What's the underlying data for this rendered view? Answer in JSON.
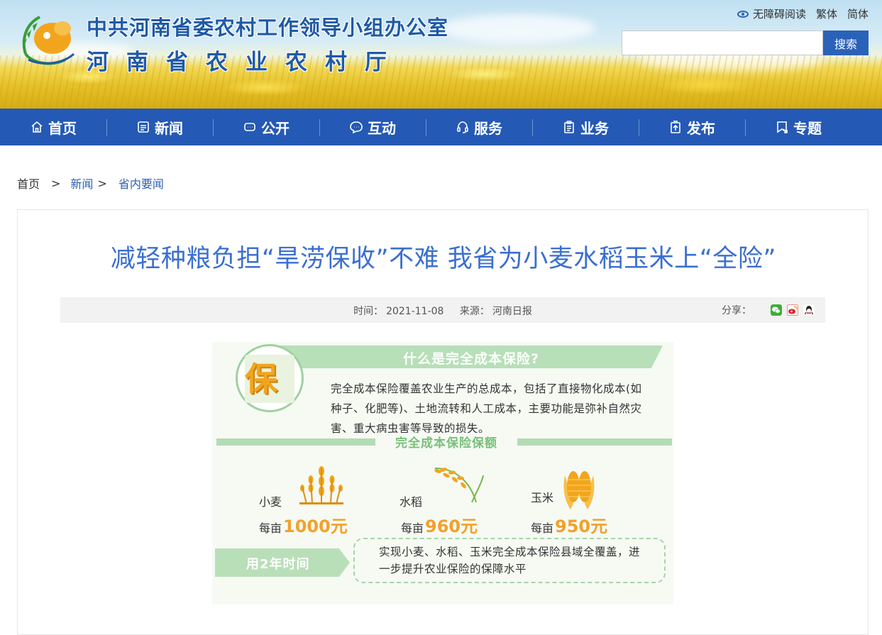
{
  "header": {
    "title_line1": "中共河南省委农村工作领导小组办公室",
    "title_line2": "河南省农业农村厅",
    "top_links": {
      "accessibility": "无障碍阅读",
      "traditional": "繁体",
      "simplified": "简体"
    },
    "search": {
      "placeholder": "",
      "button_label": "搜索"
    }
  },
  "nav": {
    "items": [
      {
        "label": "首页",
        "icon": "home-icon"
      },
      {
        "label": "新闻",
        "icon": "news-icon"
      },
      {
        "label": "公开",
        "icon": "open-icon"
      },
      {
        "label": "互动",
        "icon": "chat-icon"
      },
      {
        "label": "服务",
        "icon": "headset-icon"
      },
      {
        "label": "业务",
        "icon": "clipboard-icon"
      },
      {
        "label": "发布",
        "icon": "publish-icon"
      },
      {
        "label": "专题",
        "icon": "bookmark-icon"
      }
    ]
  },
  "breadcrumb": {
    "home": "首页",
    "sep": ">",
    "level1": "新闻",
    "level2": "省内要闻"
  },
  "article": {
    "title": "减轻种粮负担“旱涝保收”不难 我省为小麦水稻玉米上“全险”",
    "time_label": "时间：",
    "time": "2021-11-08",
    "source_label": "来源：",
    "source": "河南日报",
    "share_label": "分享："
  },
  "infographic": {
    "header": "什么是完全成本保险?",
    "icon_char": "保",
    "description": "完全成本保险覆盖农业生产的总成本，包括了直接物化成本(如种子、化肥等)、土地流转和人工成本，主要功能是弥补自然灾害、重大病虫害等导致的损失。",
    "section_title": "完全成本保险保额",
    "crops": [
      {
        "name": "小麦",
        "unit_prefix": "每亩",
        "amount": "1000元"
      },
      {
        "name": "水稻",
        "unit_prefix": "每亩",
        "amount": "960元"
      },
      {
        "name": "玉米",
        "unit_prefix": "每亩",
        "amount": "950元"
      }
    ],
    "time_tag": "用2年时间",
    "goal": "实现小麦、水稻、玉米完全成本保险县域全覆盖，进一步提升农业保险的保障水平"
  },
  "colors": {
    "nav_bg": "#2459b5",
    "title_blue": "#3b6fd0",
    "accent_green": "#b7dfb8",
    "accent_orange": "#f2a12b"
  }
}
